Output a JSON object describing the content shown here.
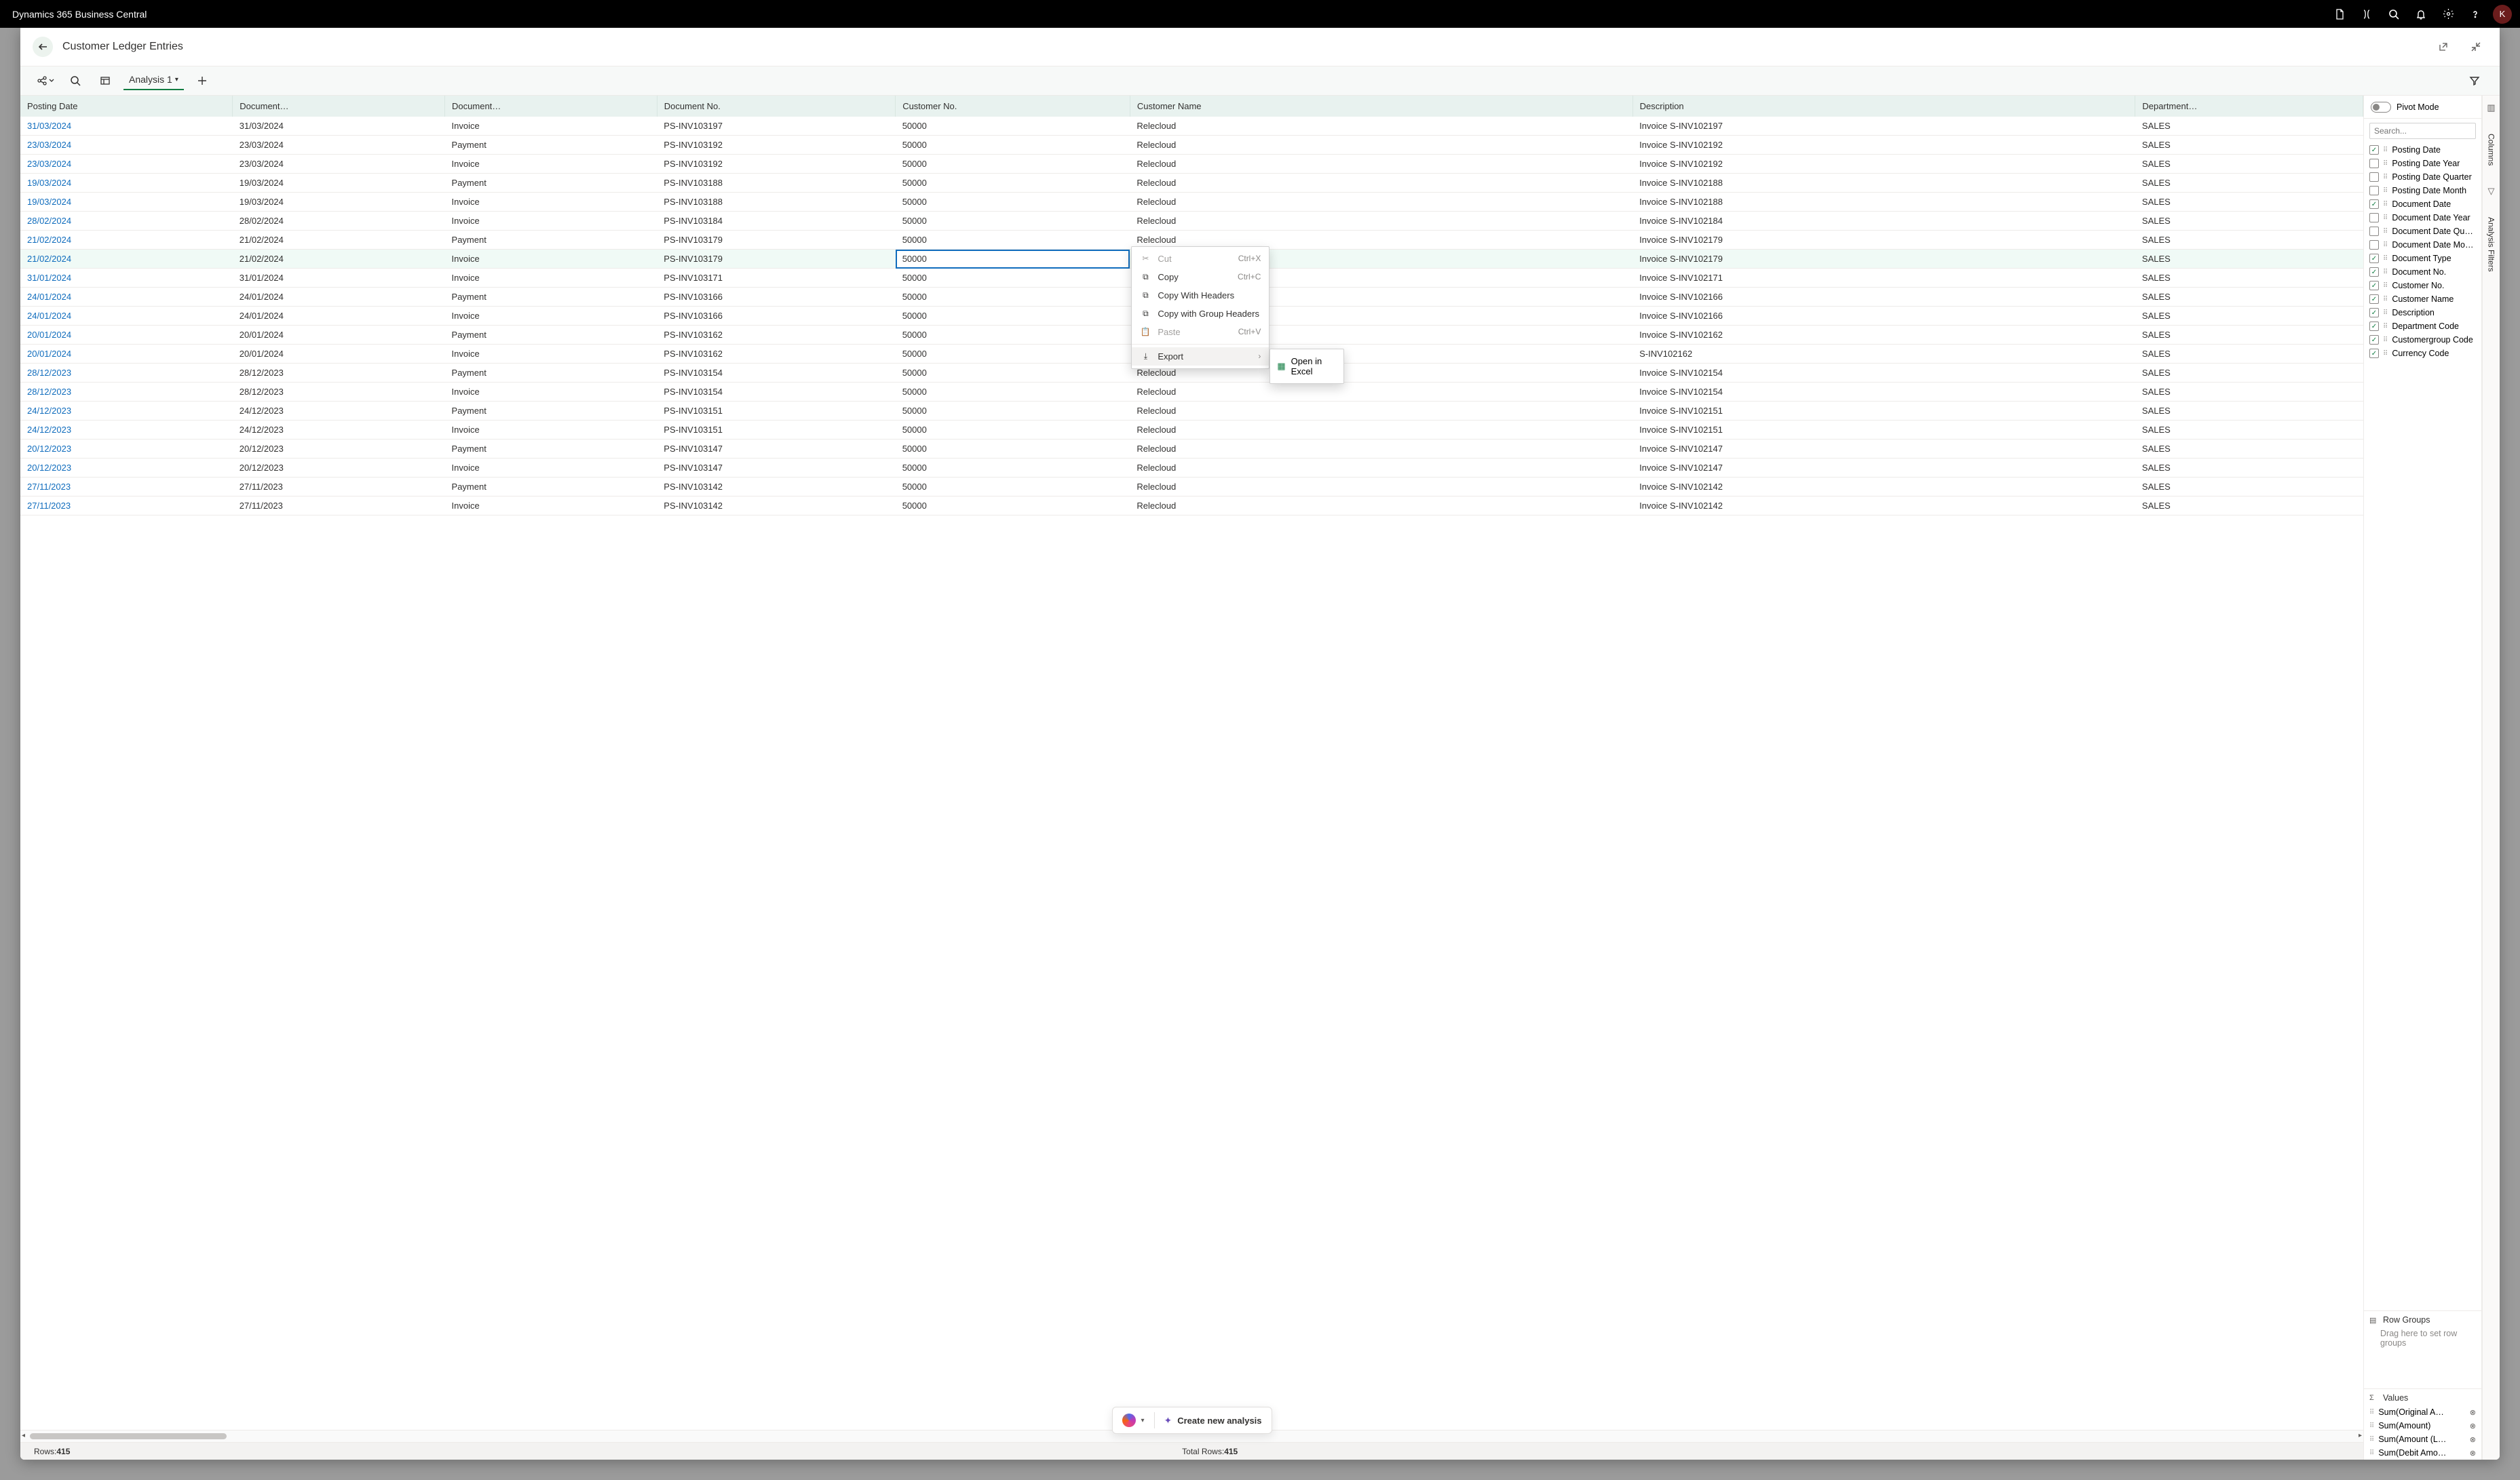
{
  "brand": "Dynamics 365 Business Central",
  "avatar_initial": "K",
  "page_title": "Customer Ledger Entries",
  "analysis_tab": "Analysis 1",
  "filter_icon": "filter-icon",
  "columns": [
    "Posting Date",
    "Document…",
    "Document…",
    "Document No.",
    "Customer No.",
    "Customer Name",
    "Description",
    "Department…"
  ],
  "rows": [
    [
      "31/03/2024",
      "31/03/2024",
      "Invoice",
      "PS-INV103197",
      "50000",
      "Relecloud",
      "Invoice S-INV102197",
      "SALES"
    ],
    [
      "23/03/2024",
      "23/03/2024",
      "Payment",
      "PS-INV103192",
      "50000",
      "Relecloud",
      "Invoice S-INV102192",
      "SALES"
    ],
    [
      "23/03/2024",
      "23/03/2024",
      "Invoice",
      "PS-INV103192",
      "50000",
      "Relecloud",
      "Invoice S-INV102192",
      "SALES"
    ],
    [
      "19/03/2024",
      "19/03/2024",
      "Payment",
      "PS-INV103188",
      "50000",
      "Relecloud",
      "Invoice S-INV102188",
      "SALES"
    ],
    [
      "19/03/2024",
      "19/03/2024",
      "Invoice",
      "PS-INV103188",
      "50000",
      "Relecloud",
      "Invoice S-INV102188",
      "SALES"
    ],
    [
      "28/02/2024",
      "28/02/2024",
      "Invoice",
      "PS-INV103184",
      "50000",
      "Relecloud",
      "Invoice S-INV102184",
      "SALES"
    ],
    [
      "21/02/2024",
      "21/02/2024",
      "Payment",
      "PS-INV103179",
      "50000",
      "Relecloud",
      "Invoice S-INV102179",
      "SALES"
    ],
    [
      "21/02/2024",
      "21/02/2024",
      "Invoice",
      "PS-INV103179",
      "50000",
      "",
      "Invoice S-INV102179",
      "SALES"
    ],
    [
      "31/01/2024",
      "31/01/2024",
      "Invoice",
      "PS-INV103171",
      "50000",
      "",
      "Invoice S-INV102171",
      "SALES"
    ],
    [
      "24/01/2024",
      "24/01/2024",
      "Payment",
      "PS-INV103166",
      "50000",
      "",
      "Invoice S-INV102166",
      "SALES"
    ],
    [
      "24/01/2024",
      "24/01/2024",
      "Invoice",
      "PS-INV103166",
      "50000",
      "",
      "Invoice S-INV102166",
      "SALES"
    ],
    [
      "20/01/2024",
      "20/01/2024",
      "Payment",
      "PS-INV103162",
      "50000",
      "",
      "Invoice S-INV102162",
      "SALES"
    ],
    [
      "20/01/2024",
      "20/01/2024",
      "Invoice",
      "PS-INV103162",
      "50000",
      "",
      "S-INV102162",
      "SALES"
    ],
    [
      "28/12/2023",
      "28/12/2023",
      "Payment",
      "PS-INV103154",
      "50000",
      "Relecloud",
      "Invoice S-INV102154",
      "SALES"
    ],
    [
      "28/12/2023",
      "28/12/2023",
      "Invoice",
      "PS-INV103154",
      "50000",
      "Relecloud",
      "Invoice S-INV102154",
      "SALES"
    ],
    [
      "24/12/2023",
      "24/12/2023",
      "Payment",
      "PS-INV103151",
      "50000",
      "Relecloud",
      "Invoice S-INV102151",
      "SALES"
    ],
    [
      "24/12/2023",
      "24/12/2023",
      "Invoice",
      "PS-INV103151",
      "50000",
      "Relecloud",
      "Invoice S-INV102151",
      "SALES"
    ],
    [
      "20/12/2023",
      "20/12/2023",
      "Payment",
      "PS-INV103147",
      "50000",
      "Relecloud",
      "Invoice S-INV102147",
      "SALES"
    ],
    [
      "20/12/2023",
      "20/12/2023",
      "Invoice",
      "PS-INV103147",
      "50000",
      "Relecloud",
      "Invoice S-INV102147",
      "SALES"
    ],
    [
      "27/11/2023",
      "27/11/2023",
      "Payment",
      "PS-INV103142",
      "50000",
      "Relecloud",
      "Invoice S-INV102142",
      "SALES"
    ],
    [
      "27/11/2023",
      "27/11/2023",
      "Invoice",
      "PS-INV103142",
      "50000",
      "Relecloud",
      "Invoice S-INV102142",
      "SALES"
    ]
  ],
  "selected_row_index": 7,
  "selected_col_index": 4,
  "ctx_menu": {
    "cut": "Cut",
    "cut_sc": "Ctrl+X",
    "copy": "Copy",
    "copy_sc": "Ctrl+C",
    "copy_headers": "Copy With Headers",
    "copy_group_headers": "Copy with Group Headers",
    "paste": "Paste",
    "paste_sc": "Ctrl+V",
    "export": "Export",
    "open_excel": "Open in Excel"
  },
  "status": {
    "rows_label": "Rows: ",
    "rows": "415",
    "total_label": "Total Rows: ",
    "total": "415"
  },
  "pill": {
    "create": "Create new analysis"
  },
  "panel": {
    "pivot_label": "Pivot Mode",
    "search_placeholder": "Search...",
    "fields": [
      {
        "name": "Posting Date",
        "on": true
      },
      {
        "name": "Posting Date Year",
        "on": false
      },
      {
        "name": "Posting Date Quarter",
        "on": false
      },
      {
        "name": "Posting Date Month",
        "on": false
      },
      {
        "name": "Document Date",
        "on": true
      },
      {
        "name": "Document Date Year",
        "on": false
      },
      {
        "name": "Document Date Quar…",
        "on": false
      },
      {
        "name": "Document Date Month",
        "on": false
      },
      {
        "name": "Document Type",
        "on": true
      },
      {
        "name": "Document No.",
        "on": true
      },
      {
        "name": "Customer No.",
        "on": true
      },
      {
        "name": "Customer Name",
        "on": true
      },
      {
        "name": "Description",
        "on": true
      },
      {
        "name": "Department Code",
        "on": true
      },
      {
        "name": "Customergroup Code",
        "on": true
      },
      {
        "name": "Currency Code",
        "on": true
      }
    ],
    "row_groups_label": "Row Groups",
    "row_groups_hint": "Drag here to set row groups",
    "values_label": "Values",
    "values": [
      "Sum(Original A…",
      "Sum(Amount)",
      "Sum(Amount (L…",
      "Sum(Debit Amo…"
    ]
  },
  "right_tabs": {
    "columns": "Columns",
    "filters": "Analysis Filters"
  }
}
